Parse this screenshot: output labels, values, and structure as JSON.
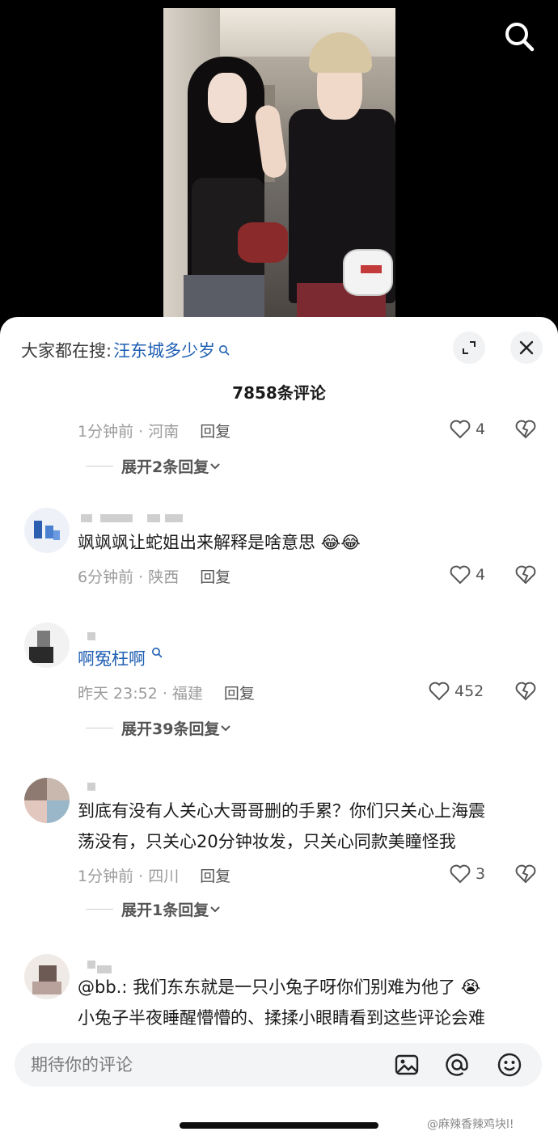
{
  "search_suggestion": {
    "prefix": "大家都在搜:",
    "keyword": "汪东城多少岁"
  },
  "comment_count_label": "7858条评论",
  "comments": [
    {
      "body": "",
      "meta": "1分钟前 · 河南",
      "reply_label": "回复",
      "likes": "4",
      "expand_label": "展开2条回复"
    },
    {
      "body": "飒飒飒让蛇姐出来解释是啥意思 😂😂",
      "meta": "6分钟前 · 陕西",
      "reply_label": "回复",
      "likes": "4"
    },
    {
      "body_link": "啊冤枉啊",
      "meta": "昨天 23:52 · 福建",
      "reply_label": "回复",
      "likes": "452",
      "expand_label": "展开39条回复"
    },
    {
      "body_lines": [
        "到底有没有人关心大哥哥删的手累？你们只关心上海震",
        "荡没有，只关心20分钟妆发，只关心同款美瞳怪我"
      ],
      "meta": "1分钟前 · 四川",
      "reply_label": "回复",
      "likes": "3",
      "expand_label": "展开1条回复"
    },
    {
      "body_lines": [
        "@bb.: 我们东东就是一只小兔子呀你们别难为他了 😭",
        "小兔子半夜睡醒懵懵的、揉揉小眼睛看到这些评论会难"
      ]
    }
  ],
  "input": {
    "placeholder": "期待你的评论"
  },
  "watermark": "@麻辣香辣鸡块l!",
  "colors": {
    "link": "#1f5fb4",
    "meta": "#9b9b9b",
    "sheet_bg": "#ffffff"
  },
  "icons": {
    "search": "search-icon",
    "expand": "fullscreen-icon",
    "close": "close-icon",
    "like": "heart-icon",
    "dislike": "broken-heart-icon",
    "image": "image-icon",
    "mention": "at-icon",
    "emoji": "emoji-icon"
  }
}
